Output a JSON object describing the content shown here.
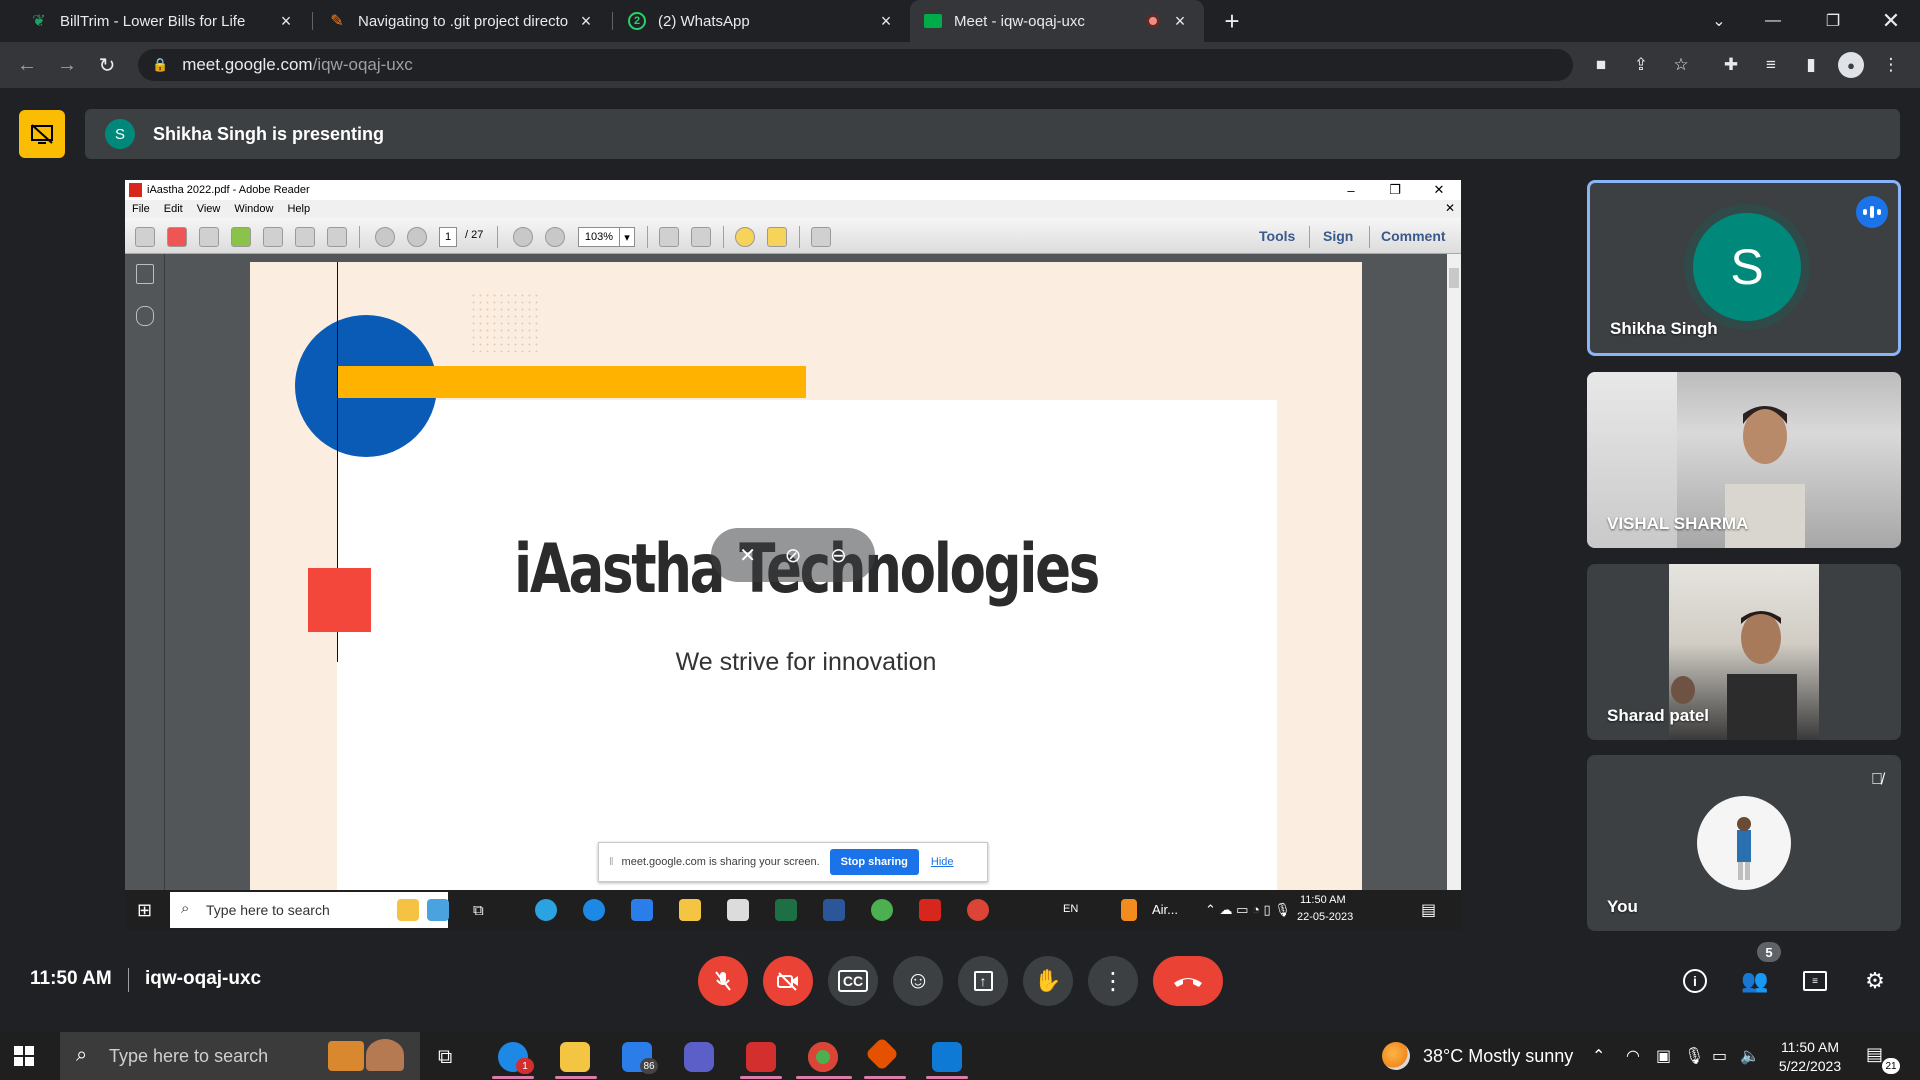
{
  "browser": {
    "tabs": [
      {
        "title": "BillTrim - Lower Bills for Life",
        "favicon": "billtrim-leaf-icon",
        "favicon_color": "#1aa260"
      },
      {
        "title": "Navigating to .git project directo",
        "favicon": "stackoverflow-icon",
        "favicon_color": "#f48024"
      },
      {
        "title": "(2) WhatsApp",
        "favicon": "whatsapp-icon",
        "favicon_color": "#25d366",
        "favicon_badge": "2"
      },
      {
        "title": "Meet - iqw-oqaj-uxc",
        "favicon": "google-meet-icon",
        "favicon_color": "#00ac47",
        "active": true
      }
    ],
    "new_tab_label": "+",
    "url_host": "meet.google.com",
    "url_path": "/iqw-oqaj-uxc"
  },
  "banner": {
    "avatar_letter": "S",
    "text": "Shikha Singh is presenting"
  },
  "shared_screen": {
    "window_title": "iAastha 2022.pdf - Adobe Reader",
    "menu": [
      "File",
      "Edit",
      "View",
      "Window",
      "Help"
    ],
    "page_current": "1",
    "page_total": "/ 27",
    "zoom": "103%",
    "right_tools": [
      "Tools",
      "Sign",
      "Comment"
    ],
    "slide": {
      "company": "iAastha Technologies",
      "tagline": "We strive for innovation"
    },
    "share_notice": {
      "text": "meet.google.com is sharing your screen.",
      "stop_label": "Stop sharing",
      "hide_label": "Hide"
    },
    "taskbar": {
      "search_placeholder": "Type here to search",
      "lang": "EN",
      "weather_short": "Air...",
      "time": "11:50 AM",
      "date": "22-05-2023"
    }
  },
  "participants": [
    {
      "name": "Shikha Singh",
      "avatar_letter": "S",
      "speaking": true
    },
    {
      "name": "VISHAL SHARMA"
    },
    {
      "name": "Sharad patel"
    },
    {
      "name": "You",
      "muted": true
    }
  ],
  "meeting": {
    "time": "11:50 AM",
    "code": "iqw-oqaj-uxc",
    "people_count": "5",
    "colors": {
      "end_call": "#ea4335",
      "accent": "#8ab4f8",
      "present": "#fbbc04"
    }
  },
  "taskbar": {
    "search_placeholder": "Type here to search",
    "mail_badge": "86",
    "edge_badge": "1",
    "weather": "38°C  Mostly sunny",
    "time": "11:50 AM",
    "date": "5/22/2023",
    "notifications": "21"
  }
}
